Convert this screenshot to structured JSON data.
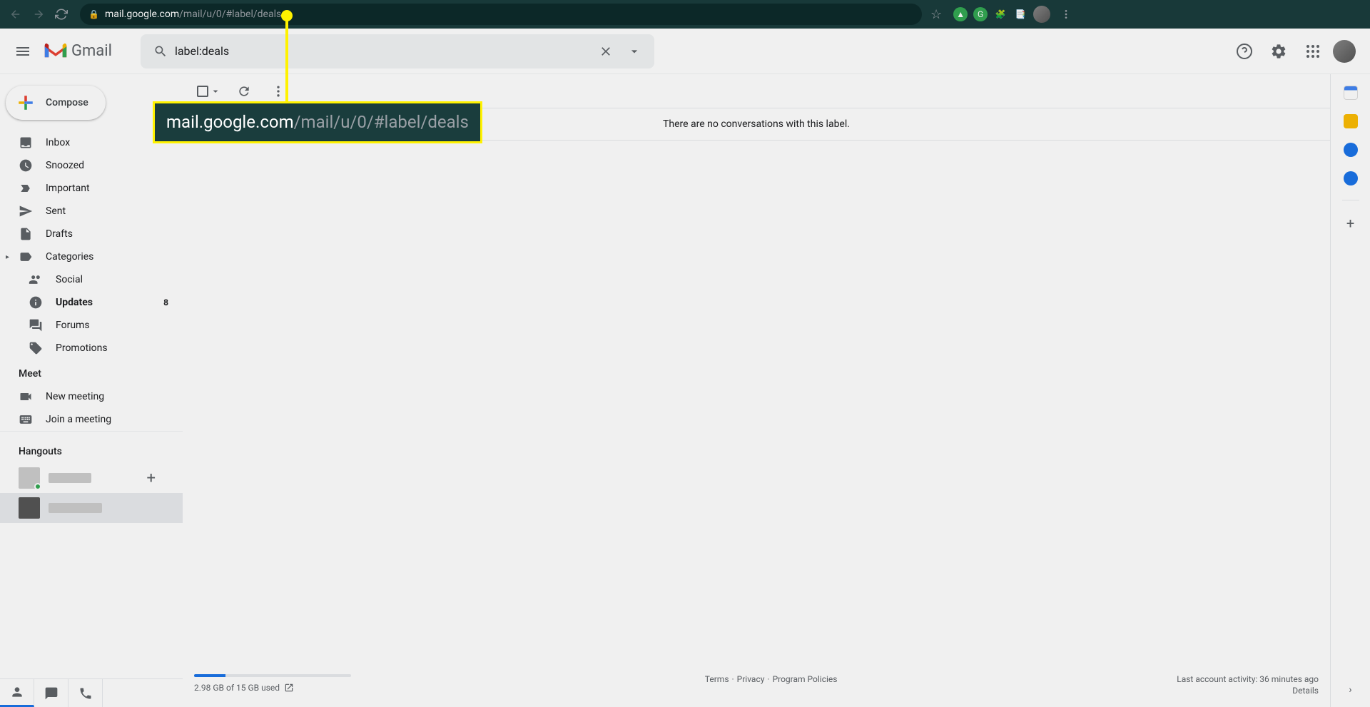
{
  "browser": {
    "url_domain": "mail.google.com",
    "url_path": "/mail/u/0/#label/deals"
  },
  "header": {
    "logo_text": "Gmail",
    "search_value": "label:deals"
  },
  "sidebar": {
    "compose_label": "Compose",
    "items": [
      {
        "label": "Inbox",
        "icon": "inbox"
      },
      {
        "label": "Snoozed",
        "icon": "clock"
      },
      {
        "label": "Important",
        "icon": "important"
      },
      {
        "label": "Sent",
        "icon": "send"
      },
      {
        "label": "Drafts",
        "icon": "draft"
      },
      {
        "label": "Categories",
        "icon": "label",
        "expandable": true
      },
      {
        "label": "Social",
        "icon": "people",
        "sub": true
      },
      {
        "label": "Updates",
        "icon": "info",
        "sub": true,
        "bold": true,
        "count": "8"
      },
      {
        "label": "Forums",
        "icon": "forum",
        "sub": true
      },
      {
        "label": "Promotions",
        "icon": "tag",
        "sub": true
      }
    ],
    "meet_header": "Meet",
    "meet_items": [
      {
        "label": "New meeting"
      },
      {
        "label": "Join a meeting"
      }
    ],
    "hangouts_header": "Hangouts"
  },
  "main": {
    "empty_message": "There are no conversations with this label."
  },
  "footer": {
    "storage_text": "2.98 GB of 15 GB used",
    "terms": "Terms",
    "privacy": "Privacy",
    "policies": "Program Policies",
    "activity": "Last account activity: 36 minutes ago",
    "details": "Details"
  },
  "annotation": {
    "domain": "mail.google.com",
    "path": "/mail/u/0/#label/deals"
  }
}
